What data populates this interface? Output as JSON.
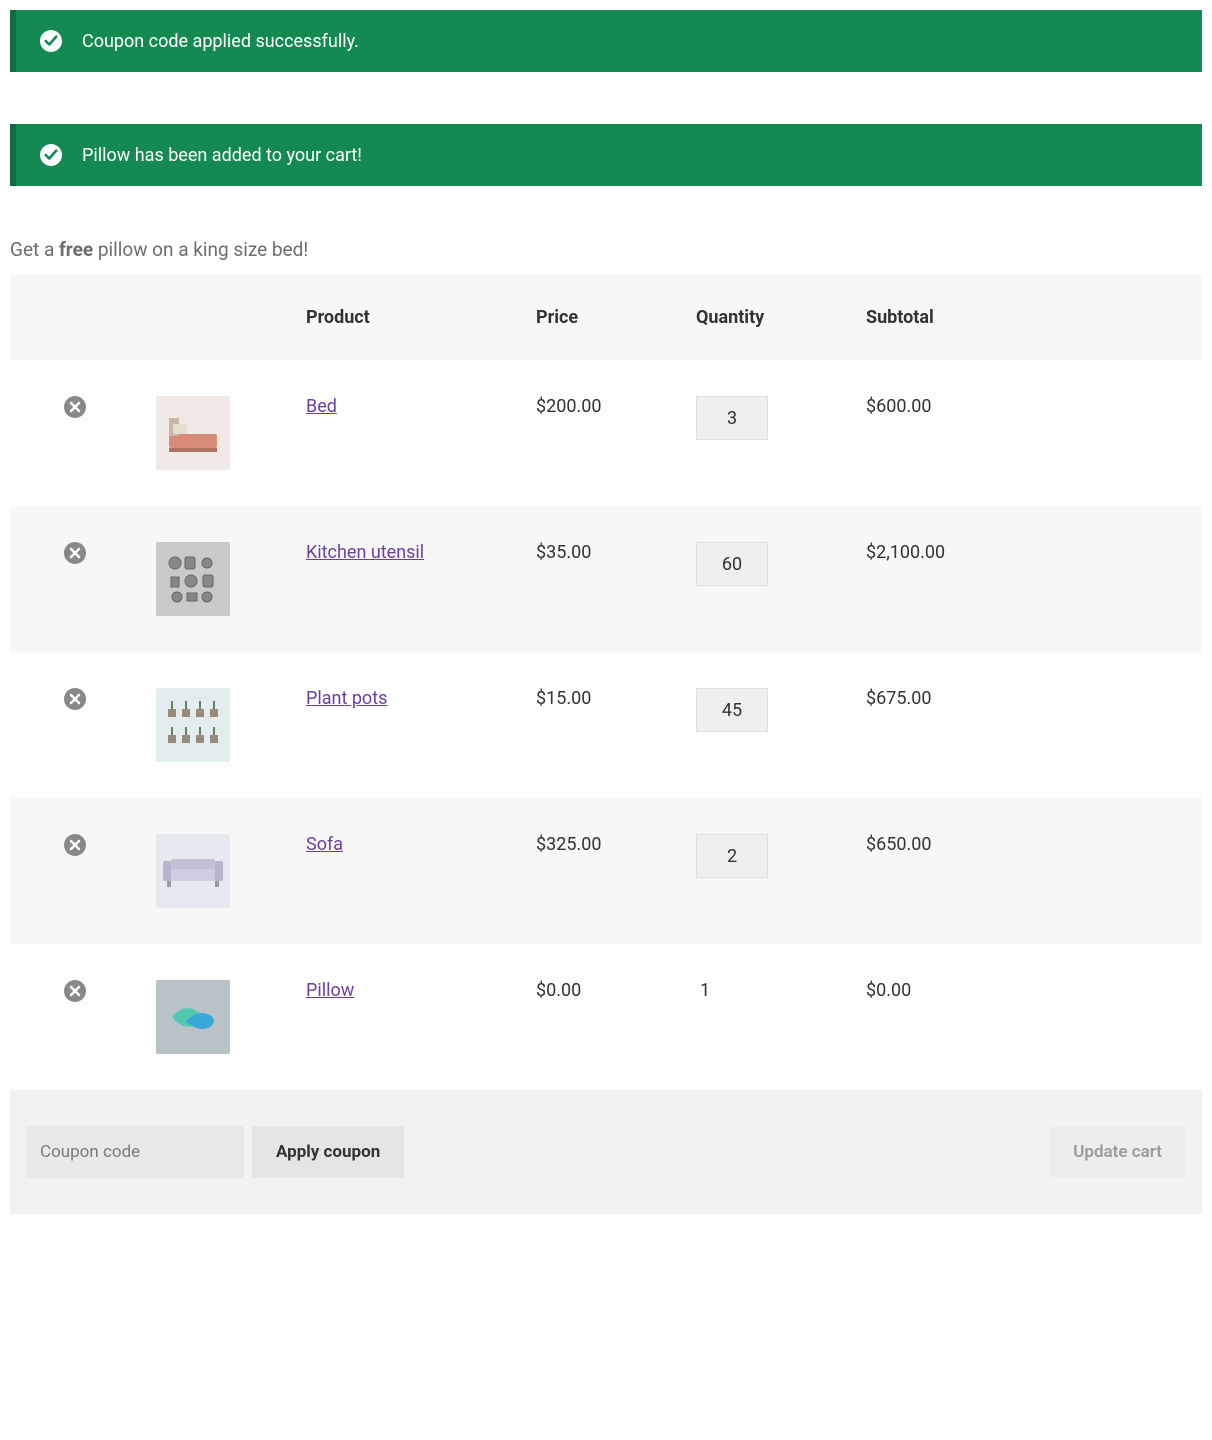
{
  "notices": [
    {
      "text": "Coupon code applied successfully."
    },
    {
      "text": "Pillow has been added to your cart!"
    }
  ],
  "promo": {
    "prefix": "Get a ",
    "bold": "free",
    "suffix": " pillow on a king size bed!"
  },
  "table": {
    "headers": {
      "product": "Product",
      "price": "Price",
      "quantity": "Quantity",
      "subtotal": "Subtotal"
    },
    "rows": [
      {
        "name": "Bed",
        "price": "$200.00",
        "qty": "3",
        "qty_editable": true,
        "subtotal": "$600.00",
        "thumb": "bed"
      },
      {
        "name": "Kitchen utensil",
        "price": "$35.00",
        "qty": "60",
        "qty_editable": true,
        "subtotal": "$2,100.00",
        "thumb": "kitchen"
      },
      {
        "name": "Plant pots",
        "price": "$15.00",
        "qty": "45",
        "qty_editable": true,
        "subtotal": "$675.00",
        "thumb": "plants"
      },
      {
        "name": "Sofa",
        "price": "$325.00",
        "qty": "2",
        "qty_editable": true,
        "subtotal": "$650.00",
        "thumb": "sofa"
      },
      {
        "name": "Pillow",
        "price": "$0.00",
        "qty": "1",
        "qty_editable": false,
        "subtotal": "$0.00",
        "thumb": "pillow"
      }
    ]
  },
  "coupon": {
    "placeholder": "Coupon code",
    "apply_label": "Apply coupon"
  },
  "update_label": "Update cart"
}
